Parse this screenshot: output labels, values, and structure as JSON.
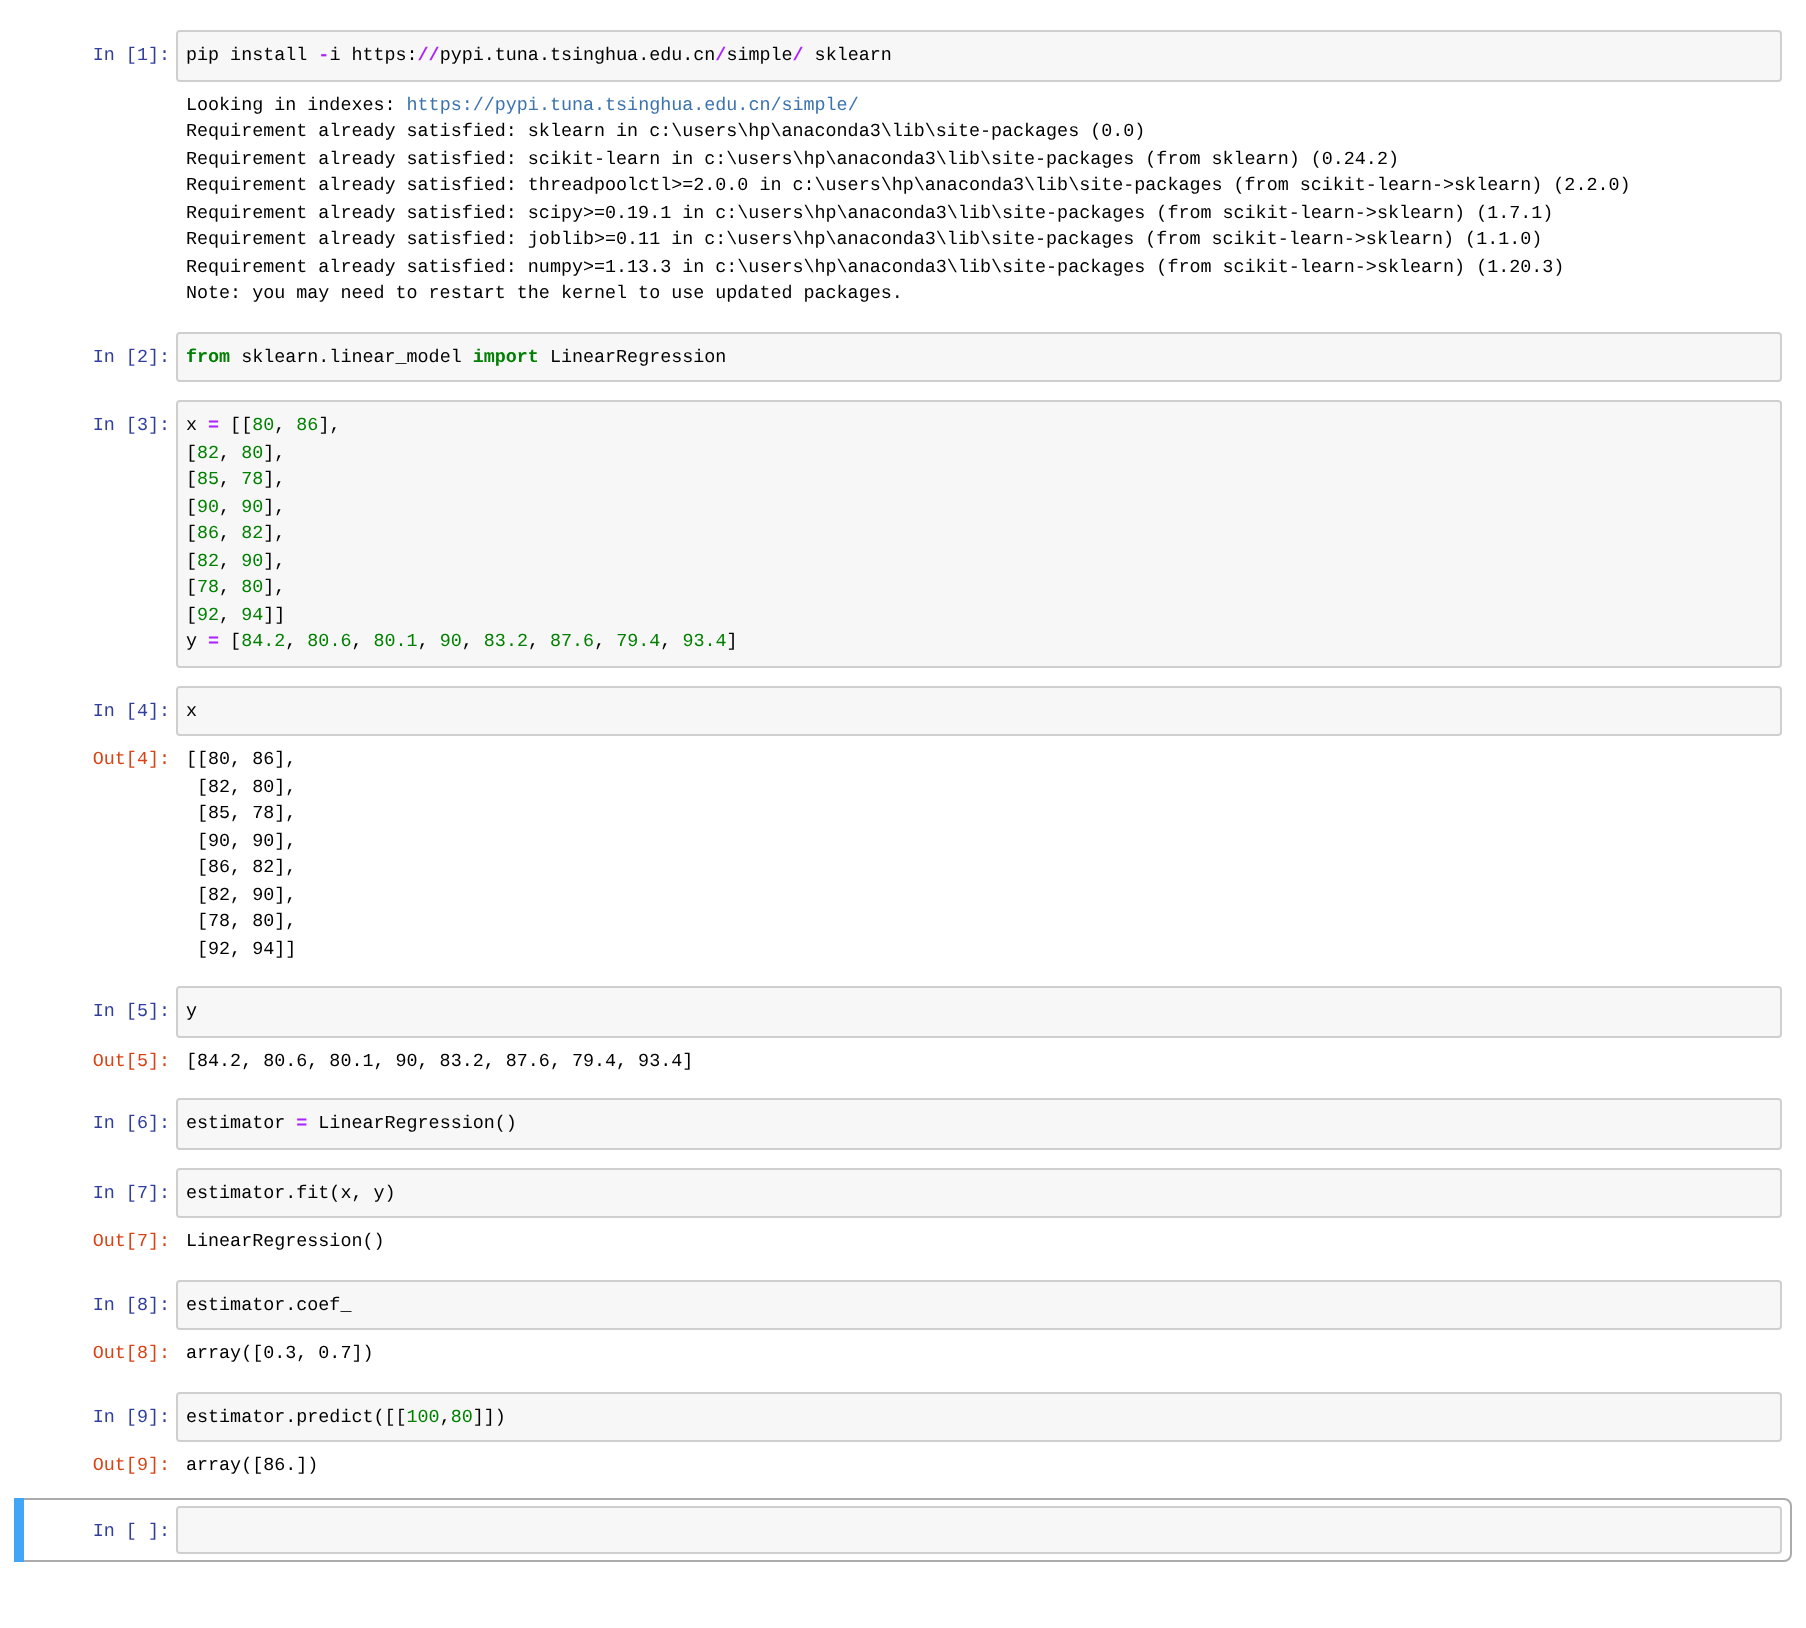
{
  "cells": [
    {
      "prompt": "In [1]:",
      "selected": false,
      "code": [
        [
          {
            "text": "pip install ",
            "kind": "plain"
          },
          {
            "text": "-",
            "kind": "operator"
          },
          {
            "text": "i https:",
            "kind": "plain"
          },
          {
            "text": "//",
            "kind": "operator"
          },
          {
            "text": "pypi.tuna.tsinghua.edu.cn",
            "kind": "plain"
          },
          {
            "text": "/",
            "kind": "operator"
          },
          {
            "text": "simple",
            "kind": "plain"
          },
          {
            "text": "/",
            "kind": "operator"
          },
          {
            "text": " sklearn",
            "kind": "plain"
          }
        ]
      ],
      "output": {
        "lines": [
          [
            {
              "text": "Looking in indexes: ",
              "kind": "plain"
            },
            {
              "text": "https://pypi.tuna.tsinghua.edu.cn/simple/",
              "kind": "link"
            }
          ],
          [
            {
              "text": "Requirement already satisfied: sklearn in c:\\users\\hp\\anaconda3\\lib\\site-packages (0.0)",
              "kind": "plain"
            }
          ],
          [
            {
              "text": "Requirement already satisfied: scikit-learn in c:\\users\\hp\\anaconda3\\lib\\site-packages (from sklearn) (0.24.2)",
              "kind": "plain"
            }
          ],
          [
            {
              "text": "Requirement already satisfied: threadpoolctl>=2.0.0 in c:\\users\\hp\\anaconda3\\lib\\site-packages (from scikit-learn->sklearn) (2.2.0)",
              "kind": "plain"
            }
          ],
          [
            {
              "text": "Requirement already satisfied: scipy>=0.19.1 in c:\\users\\hp\\anaconda3\\lib\\site-packages (from scikit-learn->sklearn) (1.7.1)",
              "kind": "plain"
            }
          ],
          [
            {
              "text": "Requirement already satisfied: joblib>=0.11 in c:\\users\\hp\\anaconda3\\lib\\site-packages (from scikit-learn->sklearn) (1.1.0)",
              "kind": "plain"
            }
          ],
          [
            {
              "text": "Requirement already satisfied: numpy>=1.13.3 in c:\\users\\hp\\anaconda3\\lib\\site-packages (from scikit-learn->sklearn) (1.20.3)",
              "kind": "plain"
            }
          ],
          [
            {
              "text": "Note: you may need to restart the kernel to use updated packages.",
              "kind": "plain"
            }
          ]
        ]
      }
    },
    {
      "prompt": "In [2]:",
      "selected": false,
      "code": [
        [
          {
            "text": "from",
            "kind": "keyword"
          },
          {
            "text": " sklearn.linear_model ",
            "kind": "plain"
          },
          {
            "text": "import",
            "kind": "keyword"
          },
          {
            "text": " LinearRegression",
            "kind": "plain"
          }
        ]
      ]
    },
    {
      "prompt": "In [3]:",
      "selected": false,
      "code": [
        [
          {
            "text": "x ",
            "kind": "plain"
          },
          {
            "text": "=",
            "kind": "operator"
          },
          {
            "text": " [[",
            "kind": "plain"
          },
          {
            "text": "80",
            "kind": "number"
          },
          {
            "text": ", ",
            "kind": "plain"
          },
          {
            "text": "86",
            "kind": "number"
          },
          {
            "text": "],",
            "kind": "plain"
          }
        ],
        [
          {
            "text": "[",
            "kind": "plain"
          },
          {
            "text": "82",
            "kind": "number"
          },
          {
            "text": ", ",
            "kind": "plain"
          },
          {
            "text": "80",
            "kind": "number"
          },
          {
            "text": "],",
            "kind": "plain"
          }
        ],
        [
          {
            "text": "[",
            "kind": "plain"
          },
          {
            "text": "85",
            "kind": "number"
          },
          {
            "text": ", ",
            "kind": "plain"
          },
          {
            "text": "78",
            "kind": "number"
          },
          {
            "text": "],",
            "kind": "plain"
          }
        ],
        [
          {
            "text": "[",
            "kind": "plain"
          },
          {
            "text": "90",
            "kind": "number"
          },
          {
            "text": ", ",
            "kind": "plain"
          },
          {
            "text": "90",
            "kind": "number"
          },
          {
            "text": "],",
            "kind": "plain"
          }
        ],
        [
          {
            "text": "[",
            "kind": "plain"
          },
          {
            "text": "86",
            "kind": "number"
          },
          {
            "text": ", ",
            "kind": "plain"
          },
          {
            "text": "82",
            "kind": "number"
          },
          {
            "text": "],",
            "kind": "plain"
          }
        ],
        [
          {
            "text": "[",
            "kind": "plain"
          },
          {
            "text": "82",
            "kind": "number"
          },
          {
            "text": ", ",
            "kind": "plain"
          },
          {
            "text": "90",
            "kind": "number"
          },
          {
            "text": "],",
            "kind": "plain"
          }
        ],
        [
          {
            "text": "[",
            "kind": "plain"
          },
          {
            "text": "78",
            "kind": "number"
          },
          {
            "text": ", ",
            "kind": "plain"
          },
          {
            "text": "80",
            "kind": "number"
          },
          {
            "text": "],",
            "kind": "plain"
          }
        ],
        [
          {
            "text": "[",
            "kind": "plain"
          },
          {
            "text": "92",
            "kind": "number"
          },
          {
            "text": ", ",
            "kind": "plain"
          },
          {
            "text": "94",
            "kind": "number"
          },
          {
            "text": "]]",
            "kind": "plain"
          }
        ],
        [
          {
            "text": "y ",
            "kind": "plain"
          },
          {
            "text": "=",
            "kind": "operator"
          },
          {
            "text": " [",
            "kind": "plain"
          },
          {
            "text": "84.2",
            "kind": "number"
          },
          {
            "text": ", ",
            "kind": "plain"
          },
          {
            "text": "80.6",
            "kind": "number"
          },
          {
            "text": ", ",
            "kind": "plain"
          },
          {
            "text": "80.1",
            "kind": "number"
          },
          {
            "text": ", ",
            "kind": "plain"
          },
          {
            "text": "90",
            "kind": "number"
          },
          {
            "text": ", ",
            "kind": "plain"
          },
          {
            "text": "83.2",
            "kind": "number"
          },
          {
            "text": ", ",
            "kind": "plain"
          },
          {
            "text": "87.6",
            "kind": "number"
          },
          {
            "text": ", ",
            "kind": "plain"
          },
          {
            "text": "79.4",
            "kind": "number"
          },
          {
            "text": ", ",
            "kind": "plain"
          },
          {
            "text": "93.4",
            "kind": "number"
          },
          {
            "text": "]",
            "kind": "plain"
          }
        ]
      ]
    },
    {
      "prompt": "In [4]:",
      "selected": false,
      "code": [
        [
          {
            "text": "x",
            "kind": "plain"
          }
        ]
      ],
      "output": {
        "prompt": "Out[4]:",
        "lines": [
          [
            {
              "text": "[[80, 86],",
              "kind": "plain"
            }
          ],
          [
            {
              "text": " [82, 80],",
              "kind": "plain"
            }
          ],
          [
            {
              "text": " [85, 78],",
              "kind": "plain"
            }
          ],
          [
            {
              "text": " [90, 90],",
              "kind": "plain"
            }
          ],
          [
            {
              "text": " [86, 82],",
              "kind": "plain"
            }
          ],
          [
            {
              "text": " [82, 90],",
              "kind": "plain"
            }
          ],
          [
            {
              "text": " [78, 80],",
              "kind": "plain"
            }
          ],
          [
            {
              "text": " [92, 94]]",
              "kind": "plain"
            }
          ]
        ]
      }
    },
    {
      "prompt": "In [5]:",
      "selected": false,
      "code": [
        [
          {
            "text": "y",
            "kind": "plain"
          }
        ]
      ],
      "output": {
        "prompt": "Out[5]:",
        "lines": [
          [
            {
              "text": "[84.2, 80.6, 80.1, 90, 83.2, 87.6, 79.4, 93.4]",
              "kind": "plain"
            }
          ]
        ]
      }
    },
    {
      "prompt": "In [6]:",
      "selected": false,
      "code": [
        [
          {
            "text": "estimator ",
            "kind": "plain"
          },
          {
            "text": "=",
            "kind": "operator"
          },
          {
            "text": " LinearRegression()",
            "kind": "plain"
          }
        ]
      ]
    },
    {
      "prompt": "In [7]:",
      "selected": false,
      "code": [
        [
          {
            "text": "estimator.fit(x, y)",
            "kind": "plain"
          }
        ]
      ],
      "output": {
        "prompt": "Out[7]:",
        "lines": [
          [
            {
              "text": "LinearRegression()",
              "kind": "plain"
            }
          ]
        ]
      }
    },
    {
      "prompt": "In [8]:",
      "selected": false,
      "code": [
        [
          {
            "text": "estimator.coef_",
            "kind": "plain"
          }
        ]
      ],
      "output": {
        "prompt": "Out[8]:",
        "lines": [
          [
            {
              "text": "array([0.3, 0.7])",
              "kind": "plain"
            }
          ]
        ]
      }
    },
    {
      "prompt": "In [9]:",
      "selected": false,
      "code": [
        [
          {
            "text": "estimator.predict([[",
            "kind": "plain"
          },
          {
            "text": "100",
            "kind": "number"
          },
          {
            "text": ",",
            "kind": "plain"
          },
          {
            "text": "80",
            "kind": "number"
          },
          {
            "text": "]])",
            "kind": "plain"
          }
        ]
      ],
      "output": {
        "prompt": "Out[9]:",
        "lines": [
          [
            {
              "text": "array([86.])",
              "kind": "plain"
            }
          ]
        ]
      }
    },
    {
      "prompt": "In [ ]:",
      "selected": true
    }
  ]
}
